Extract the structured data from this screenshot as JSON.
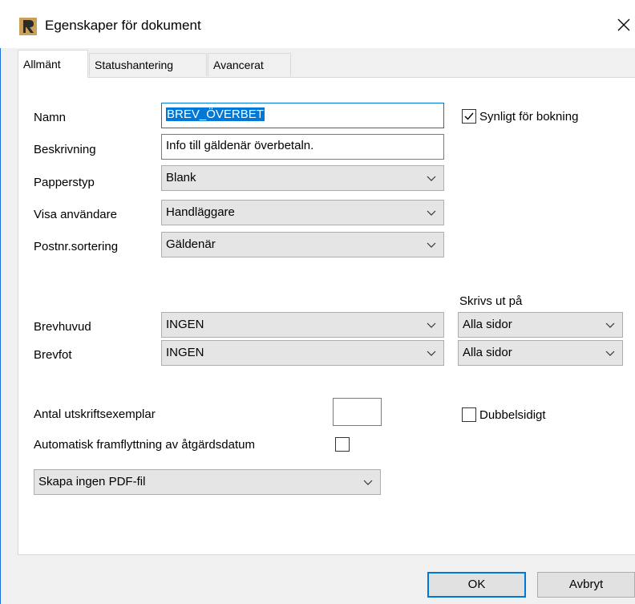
{
  "window": {
    "title": "Egenskaper för dokument",
    "close_glyph": "✕"
  },
  "tabs": [
    {
      "label": "Allmänt",
      "active": true
    },
    {
      "label": "Statushantering",
      "active": false
    },
    {
      "label": "Avancerat",
      "active": false
    }
  ],
  "form": {
    "namn": {
      "label": "Namn",
      "value": "BREV_ÖVERBET"
    },
    "beskrivning": {
      "label": "Beskrivning",
      "value": "Info till gäldenär överbetaln."
    },
    "papperstyp": {
      "label": "Papperstyp",
      "value": "Blank"
    },
    "visa_anvandare": {
      "label": "Visa användare",
      "value": "Handläggare"
    },
    "postnr_sortering": {
      "label": "Postnr.sortering",
      "value": "Gäldenär"
    },
    "synligt": {
      "label": "Synligt för bokning",
      "checked": true
    },
    "skrivs_ut_pa": {
      "label": "Skrivs ut på"
    },
    "brevhuvud": {
      "label": "Brevhuvud",
      "value": "INGEN",
      "pages": "Alla sidor"
    },
    "brevfot": {
      "label": "Brevfot",
      "value": "INGEN",
      "pages": "Alla sidor"
    },
    "antal": {
      "label": "Antal utskriftsexemplar",
      "value": ""
    },
    "dubbelsidigt": {
      "label": "Dubbelsidigt",
      "checked": false
    },
    "automatisk": {
      "label": "Automatisk framflyttning av åtgärdsdatum",
      "checked": false
    },
    "pdf": {
      "value": "Skapa ingen PDF-fil"
    }
  },
  "buttons": {
    "ok": "OK",
    "cancel": "Avbryt"
  },
  "colors": {
    "accent": "#0078d7",
    "combo_bg": "#e5e5e5",
    "window_bg": "#f0f0f0"
  },
  "icons": {
    "app": "document-app-icon",
    "close": "close-icon",
    "chevron": "chevron-down-icon",
    "check": "checkmark-icon"
  }
}
